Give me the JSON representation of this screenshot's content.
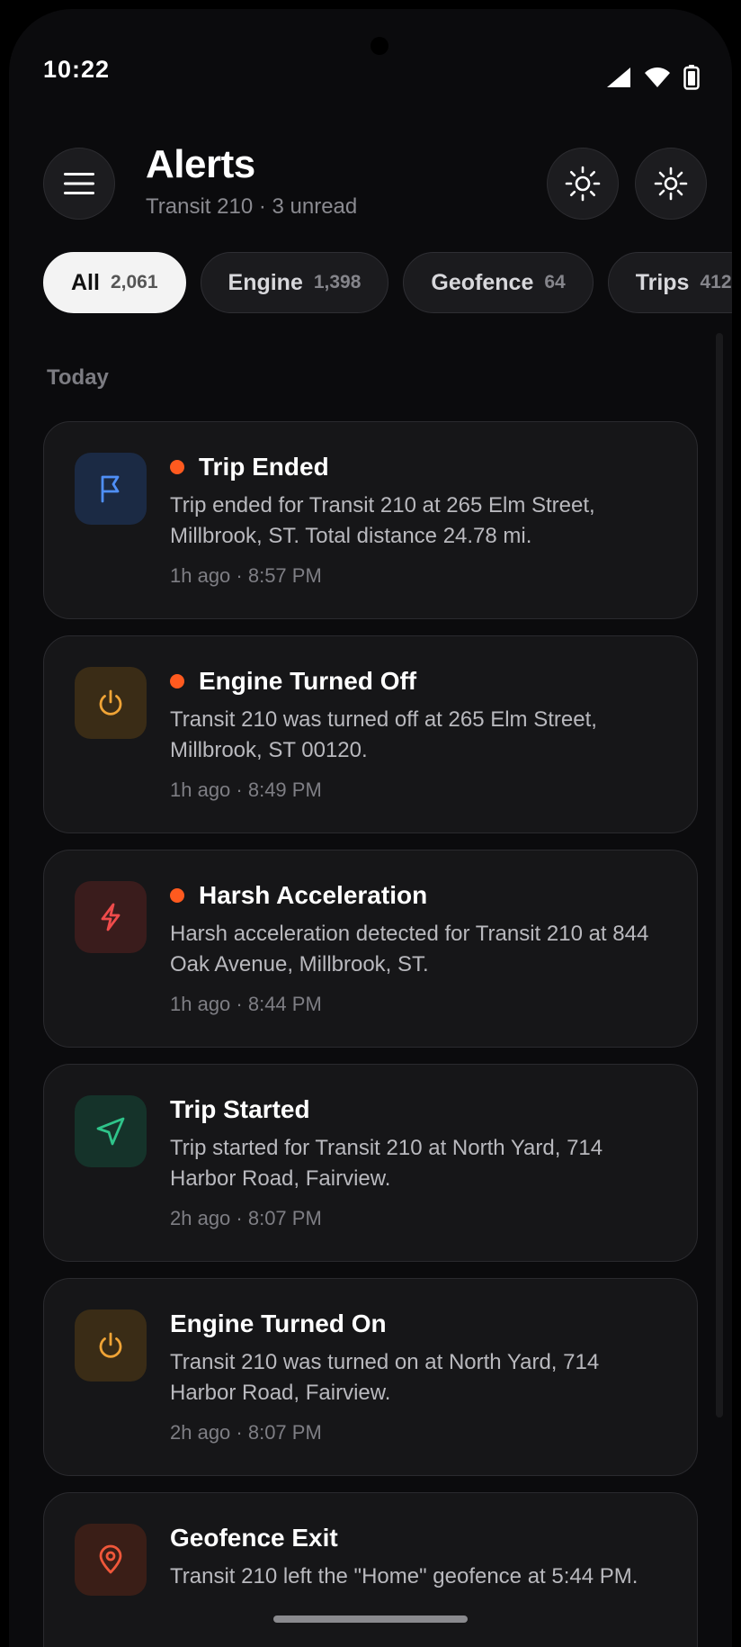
{
  "status_bar": {
    "time": "10:22"
  },
  "header": {
    "title": "Alerts",
    "subtitle": "Transit 210 · 3 unread"
  },
  "tabs": [
    {
      "label": "All",
      "count": "2,061",
      "active": true
    },
    {
      "label": "Engine",
      "count": "1,398",
      "active": false
    },
    {
      "label": "Geofence",
      "count": "64",
      "active": false
    },
    {
      "label": "Trips",
      "count": "412",
      "active": false
    }
  ],
  "section": {
    "label": "Today"
  },
  "alerts": [
    {
      "title": "Trip Ended",
      "description": "Trip ended for Transit 210 at 265 Elm Street, Millbrook, ST. Total distance 24.78 mi.",
      "time": "1h ago · 8:57 PM",
      "unread": true,
      "icon": "flag-icon",
      "icon_color": "#4f8ff7",
      "icon_bg": "#1b2a44"
    },
    {
      "title": "Engine Turned Off",
      "description": "Transit 210 was turned off at 265 Elm Street, Millbrook, ST 00120.",
      "time": "1h ago · 8:49 PM",
      "unread": true,
      "icon": "power-icon",
      "icon_color": "#f0a436",
      "icon_bg": "#3a2c16"
    },
    {
      "title": "Harsh Acceleration",
      "description": "Harsh acceleration detected for Transit 210 at 844 Oak Avenue, Millbrook, ST.",
      "time": "1h ago · 8:44 PM",
      "unread": true,
      "icon": "lightning-icon",
      "icon_color": "#ef4b4b",
      "icon_bg": "#3a1c1c"
    },
    {
      "title": "Trip Started",
      "description": "Trip started for Transit 210 at North Yard, 714 Harbor Road, Fairview.",
      "time": "2h ago · 8:07 PM",
      "unread": false,
      "icon": "navigation-arrow-icon",
      "icon_color": "#2fc48a",
      "icon_bg": "#15332a"
    },
    {
      "title": "Engine Turned On",
      "description": "Transit 210 was turned on at North Yard, 714 Harbor Road, Fairview.",
      "time": "2h ago · 8:07 PM",
      "unread": false,
      "icon": "power-icon",
      "icon_color": "#f0a436",
      "icon_bg": "#3a2c16"
    },
    {
      "title": "Geofence Exit",
      "description": "Transit 210 left the \"Home\" geofence at 5:44 PM.",
      "time": "",
      "unread": false,
      "icon": "map-pin-icon",
      "icon_color": "#f0573a",
      "icon_bg": "#3a1e17"
    }
  ],
  "colors": {
    "unread_dot": "#ff5a1f",
    "background": "#0b0b0d",
    "card": "#161618"
  }
}
